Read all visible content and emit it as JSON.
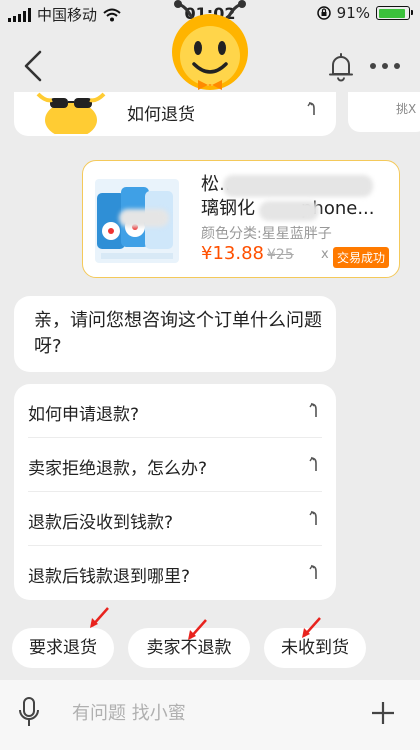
{
  "status_bar": {
    "carrier": "中国移动",
    "time": "01:02",
    "battery_pct": "91%",
    "battery_level": 0.91
  },
  "nav": {
    "back_icon": "chevron-left-icon",
    "mascot": "bee-mascot-avatar",
    "bell_icon": "bell-icon",
    "more_icon": "more-dots-icon"
  },
  "prev_card": {
    "label": "如何退货",
    "side_label": "挑X"
  },
  "product": {
    "title_line1": "松",
    "title_line1_tail": "玻",
    "title_line2": "璃钢化",
    "title_line2_tail": "phone...",
    "variant": "颜色分类:星星蓝胖子",
    "price": "¥13.88",
    "original_price": "¥25",
    "qty": "x",
    "status_badge": "交易成功"
  },
  "bot_message": {
    "text": "亲，请问您想咨询这个订单什么问题呀?"
  },
  "faq": {
    "items": [
      {
        "label": "如何申请退款?"
      },
      {
        "label": "卖家拒绝退款，怎么办?"
      },
      {
        "label": "退款后没收到钱款?"
      },
      {
        "label": "退款后钱款退到哪里?"
      }
    ]
  },
  "quick_replies": [
    {
      "label": "要求退货"
    },
    {
      "label": "卖家不退款"
    },
    {
      "label": "未收到货"
    }
  ],
  "input": {
    "placeholder": "有问题 找小蜜",
    "mic_icon": "microphone-icon",
    "plus_icon": "plus-icon"
  },
  "colors": {
    "accent_orange": "#ff5000",
    "badge_orange": "#ff7a00",
    "annotation_red": "#e8231e",
    "card_border": "#f4c95a"
  }
}
